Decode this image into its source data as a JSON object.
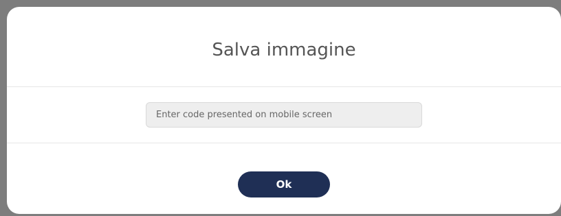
{
  "dialog": {
    "title": "Salva immagine",
    "code_input": {
      "value": "",
      "placeholder": "Enter code presented on mobile screen"
    },
    "ok_label": "Ok"
  },
  "colors": {
    "backdrop": "#7d7d7d",
    "modal_background": "#ffffff",
    "button_background": "#1f2f55",
    "button_text": "#ffffff",
    "input_background": "#eeeeee"
  }
}
